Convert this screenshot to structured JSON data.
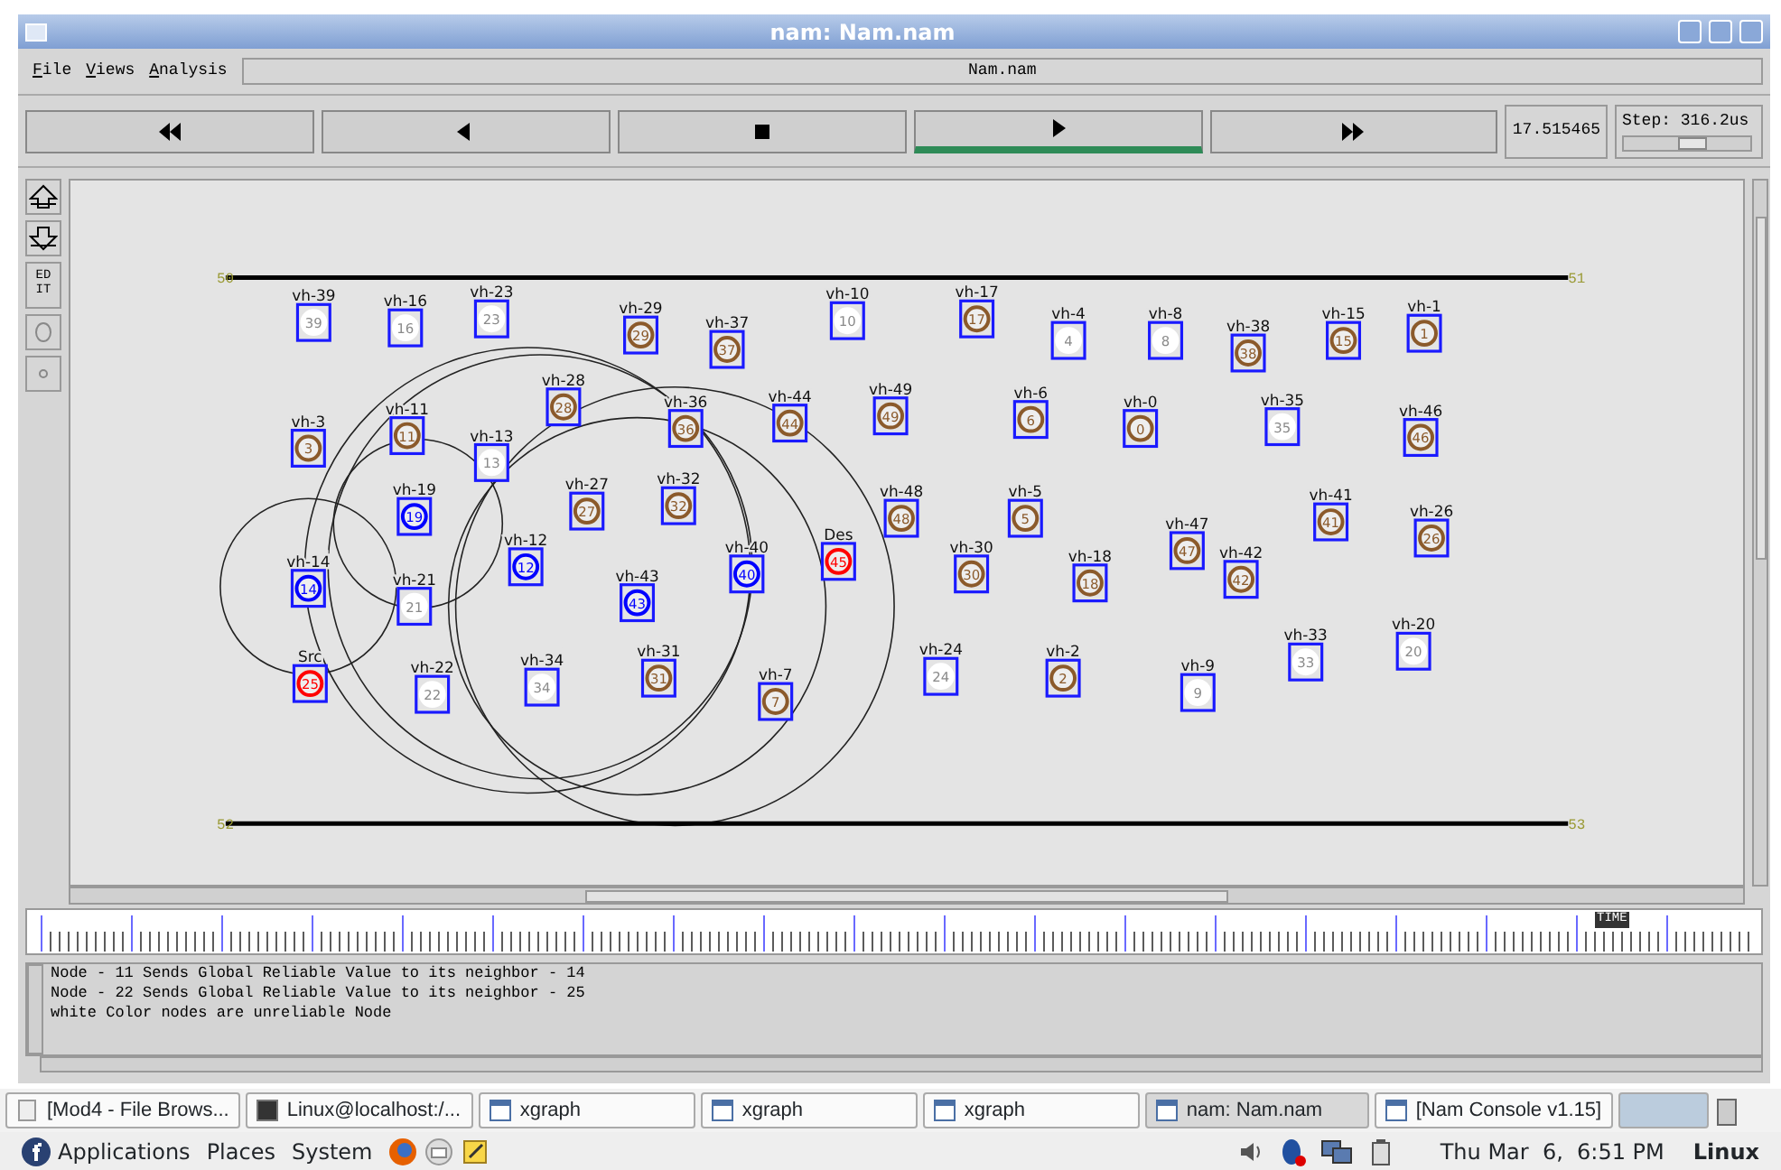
{
  "window": {
    "title": "nam: Nam.nam"
  },
  "menu": [
    {
      "label": "File"
    },
    {
      "label": "Views"
    },
    {
      "label": "Analysis"
    }
  ],
  "file_label": "Nam.nam",
  "controls": [
    {
      "kind": "rewind",
      "selected": false
    },
    {
      "kind": "back",
      "selected": false
    },
    {
      "kind": "stop",
      "selected": false
    },
    {
      "kind": "play",
      "selected": true
    },
    {
      "kind": "forward",
      "selected": false
    }
  ],
  "time": "17.515465",
  "step": {
    "label": "Step: 316.2us",
    "level": 0.55
  },
  "tools": [
    {
      "kind": "zoom-in"
    },
    {
      "kind": "zoom-out"
    },
    {
      "kind": "edit",
      "label": "EDIT"
    },
    {
      "kind": "round"
    },
    {
      "kind": "dot"
    }
  ],
  "canvas": {
    "corner_labels": [
      "50",
      "51",
      "52",
      "53"
    ],
    "nodes": [
      {
        "label": "vh-39",
        "number": "39",
        "color": "#ffffff"
      },
      {
        "label": "vh-16",
        "number": "16",
        "color": "#ffffff"
      },
      {
        "label": "vh-23",
        "number": "23",
        "color": "#ffffff"
      },
      {
        "label": "vh-29",
        "number": "29",
        "color": "#8b5a2b"
      },
      {
        "label": "vh-37",
        "number": "37",
        "color": "#8b5a2b"
      },
      {
        "label": "vh-10",
        "number": "10",
        "color": "#ffffff"
      },
      {
        "label": "vh-17",
        "number": "17",
        "color": "#8b5a2b"
      },
      {
        "label": "vh-4",
        "number": "4",
        "color": "#ffffff"
      },
      {
        "label": "vh-8",
        "number": "8",
        "color": "#ffffff"
      },
      {
        "label": "vh-38",
        "number": "38",
        "color": "#8b5a2b"
      },
      {
        "label": "vh-15",
        "number": "15",
        "color": "#8b5a2b"
      },
      {
        "label": "vh-1",
        "number": "1",
        "color": "#8b5a2b"
      },
      {
        "label": "vh-3",
        "number": "3",
        "color": "#8b5a2b"
      },
      {
        "label": "vh-11",
        "number": "11",
        "color": "#8b5a2b"
      },
      {
        "label": "vh-13",
        "number": "13",
        "color": "#ffffff"
      },
      {
        "label": "vh-28",
        "number": "28",
        "color": "#8b5a2b"
      },
      {
        "label": "vh-36",
        "number": "36",
        "color": "#8b5a2b"
      },
      {
        "label": "vh-44",
        "number": "44",
        "color": "#8b5a2b"
      },
      {
        "label": "vh-49",
        "number": "49",
        "color": "#8b5a2b"
      },
      {
        "label": "vh-6",
        "number": "6",
        "color": "#8b5a2b"
      },
      {
        "label": "vh-0",
        "number": "0",
        "color": "#8b5a2b"
      },
      {
        "label": "vh-35",
        "number": "35",
        "color": "#ffffff"
      },
      {
        "label": "vh-46",
        "number": "46",
        "color": "#8b5a2b"
      },
      {
        "label": "vh-19",
        "number": "19",
        "color": "#0000ff"
      },
      {
        "label": "vh-27",
        "number": "27",
        "color": "#8b5a2b"
      },
      {
        "label": "vh-32",
        "number": "32",
        "color": "#8b5a2b"
      },
      {
        "label": "vh-48",
        "number": "48",
        "color": "#8b5a2b"
      },
      {
        "label": "vh-5",
        "number": "5",
        "color": "#8b5a2b"
      },
      {
        "label": "vh-47",
        "number": "47",
        "color": "#8b5a2b"
      },
      {
        "label": "vh-41",
        "number": "41",
        "color": "#8b5a2b"
      },
      {
        "label": "vh-26",
        "number": "26",
        "color": "#8b5a2b"
      },
      {
        "label": "vh-14",
        "number": "14",
        "color": "#0000ff"
      },
      {
        "label": "vh-12",
        "number": "12",
        "color": "#0000ff"
      },
      {
        "label": "vh-43",
        "number": "43",
        "color": "#0000ff"
      },
      {
        "label": "vh-40",
        "number": "40",
        "color": "#0000ff"
      },
      {
        "label": "Des",
        "number": "45",
        "color": "#ff0000"
      },
      {
        "label": "vh-30",
        "number": "30",
        "color": "#8b5a2b"
      },
      {
        "label": "vh-18",
        "number": "18",
        "color": "#8b5a2b"
      },
      {
        "label": "vh-42",
        "number": "42",
        "color": "#8b5a2b"
      },
      {
        "label": "vh-21",
        "number": "21",
        "color": "#ffffff"
      },
      {
        "label": "Src",
        "number": "25",
        "color": "#ff0000"
      },
      {
        "label": "vh-22",
        "number": "22",
        "color": "#ffffff"
      },
      {
        "label": "vh-34",
        "number": "34",
        "color": "#ffffff"
      },
      {
        "label": "vh-31",
        "number": "31",
        "color": "#8b5a2b"
      },
      {
        "label": "vh-7",
        "number": "7",
        "color": "#8b5a2b"
      },
      {
        "label": "vh-24",
        "number": "24",
        "color": "#ffffff"
      },
      {
        "label": "vh-2",
        "number": "2",
        "color": "#8b5a2b"
      },
      {
        "label": "vh-9",
        "number": "9",
        "color": "#ffffff"
      },
      {
        "label": "vh-33",
        "number": "33",
        "color": "#ffffff"
      },
      {
        "label": "vh-20",
        "number": "20",
        "color": "#ffffff"
      }
    ]
  },
  "timeline": {
    "marker": "TIME"
  },
  "log": [
    "Node - 11 Sends Global Reliable Value to its neighbor - 14",
    "Node - 22 Sends Global Reliable Value to its neighbor - 25",
    "white Color nodes are unreliable Node"
  ],
  "taskbar": [
    {
      "kind": "files",
      "label": "[Mod4 - File Brows...",
      "selected": false
    },
    {
      "kind": "terminal",
      "label": "Linux@localhost:/...",
      "selected": false
    },
    {
      "kind": "window",
      "label": "xgraph",
      "selected": false
    },
    {
      "kind": "window",
      "label": "xgraph",
      "selected": false
    },
    {
      "kind": "window",
      "label": "xgraph",
      "selected": false
    },
    {
      "kind": "window",
      "label": "nam: Nam.nam",
      "selected": true
    },
    {
      "kind": "window",
      "label": "[Nam Console v1.15]",
      "selected": false
    }
  ],
  "panel": {
    "menus": [
      "Applications",
      "Places",
      "System"
    ],
    "clock": "Thu Mar  6,  6:51 PM",
    "user": "Linux"
  }
}
